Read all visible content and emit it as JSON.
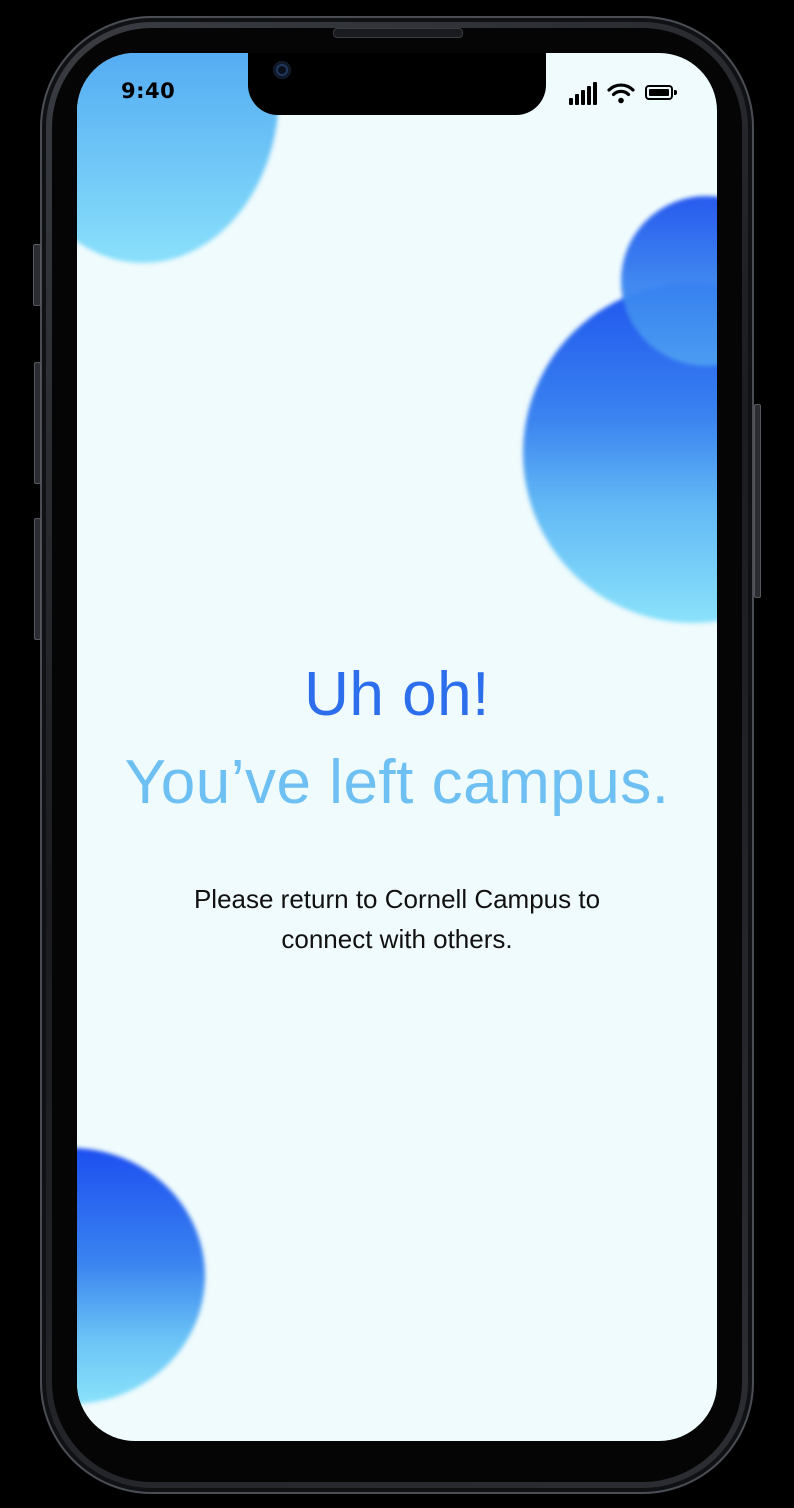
{
  "status_bar": {
    "time": "9:40",
    "icons": [
      "signal-icon",
      "wifi-icon",
      "battery-icon"
    ]
  },
  "message": {
    "title": "Uh oh!",
    "subtitle": "You’ve left campus.",
    "body": "Please return to Cornell Campus to connect with others."
  },
  "colors": {
    "background": "#effbfd",
    "title": "#2d6eec",
    "subtitle": "#6ec0f3",
    "body": "#111111",
    "blob_dark": "#1f55ee",
    "blob_light": "#8ae2fb"
  }
}
